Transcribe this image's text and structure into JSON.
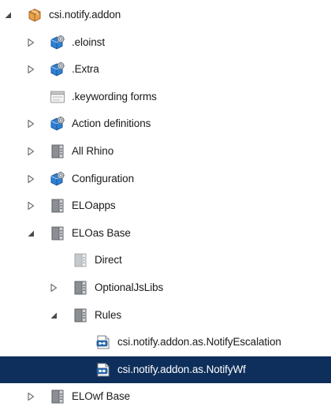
{
  "tree": {
    "items": [
      {
        "label": "csi.notify.addon",
        "icon": "package-icon",
        "toggle": "expanded",
        "depth": 0,
        "selected": false
      },
      {
        "label": ".eloinst",
        "icon": "blue-gear-cube-icon",
        "toggle": "collapsed",
        "depth": 1,
        "selected": false
      },
      {
        "label": ".Extra",
        "icon": "blue-gear-cube-icon",
        "toggle": "collapsed",
        "depth": 1,
        "selected": false
      },
      {
        "label": ".keywording forms",
        "icon": "form-icon",
        "toggle": "none",
        "depth": 1,
        "selected": false
      },
      {
        "label": "Action definitions",
        "icon": "blue-gear-cube-icon",
        "toggle": "collapsed",
        "depth": 1,
        "selected": false
      },
      {
        "label": "All Rhino",
        "icon": "binder-icon",
        "toggle": "collapsed",
        "depth": 1,
        "selected": false
      },
      {
        "label": "Configuration",
        "icon": "blue-gear-cube-icon",
        "toggle": "collapsed",
        "depth": 1,
        "selected": false
      },
      {
        "label": "ELOapps",
        "icon": "binder-icon",
        "toggle": "collapsed",
        "depth": 1,
        "selected": false
      },
      {
        "label": "ELOas Base",
        "icon": "binder-icon",
        "toggle": "expanded",
        "depth": 1,
        "selected": false
      },
      {
        "label": "Direct",
        "icon": "binder-light-icon",
        "toggle": "none",
        "depth": 2,
        "selected": false
      },
      {
        "label": "OptionalJsLibs",
        "icon": "binder-icon",
        "toggle": "collapsed",
        "depth": 2,
        "selected": false
      },
      {
        "label": "Rules",
        "icon": "binder-icon",
        "toggle": "expanded",
        "depth": 2,
        "selected": false
      },
      {
        "label": "csi.notify.addon.as.NotifyEscalation",
        "icon": "script-document-icon",
        "toggle": "none",
        "depth": 3,
        "selected": false
      },
      {
        "label": "csi.notify.addon.as.NotifyWf",
        "icon": "script-document-icon",
        "toggle": "none",
        "depth": 3,
        "selected": true
      },
      {
        "label": "ELOwf Base",
        "icon": "binder-icon",
        "toggle": "collapsed",
        "depth": 1,
        "selected": false
      }
    ]
  }
}
